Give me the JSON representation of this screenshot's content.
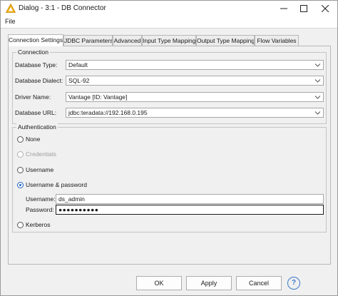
{
  "window": {
    "title": "Dialog - 3:1 - DB Connector"
  },
  "menu": {
    "file": "File"
  },
  "tabs": [
    {
      "label": "Connection Settings",
      "active": true
    },
    {
      "label": "JDBC Parameters",
      "active": false
    },
    {
      "label": "Advanced",
      "active": false
    },
    {
      "label": "Input Type Mapping",
      "active": false
    },
    {
      "label": "Output Type Mapping",
      "active": false
    },
    {
      "label": "Flow Variables",
      "active": false
    }
  ],
  "connection": {
    "title": "Connection",
    "database_type_label": "Database Type:",
    "database_type_value": "Default",
    "database_dialect_label": "Database Dialect:",
    "database_dialect_value": "SQL-92",
    "driver_name_label": "Driver Name:",
    "driver_name_value": "Vantage [ID: Vantage]",
    "database_url_label": "Database URL:",
    "database_url_value": "jdbc:teradata://192.168.0.195"
  },
  "authentication": {
    "title": "Authentication",
    "options": [
      {
        "label": "None",
        "checked": false,
        "disabled": false
      },
      {
        "label": "Credentials",
        "checked": false,
        "disabled": true
      },
      {
        "label": "Username",
        "checked": false,
        "disabled": false
      },
      {
        "label": "Username & password",
        "checked": true,
        "disabled": false
      },
      {
        "label": "Kerberos",
        "checked": false,
        "disabled": false
      }
    ],
    "username_label": "Username:",
    "username_value": "ds_admin",
    "password_label": "Password:",
    "password_value": "●●●●●●●●●●"
  },
  "buttons": {
    "ok": "OK",
    "apply": "Apply",
    "cancel": "Cancel",
    "help": "?"
  },
  "colors": {
    "accent": "#1b62c2",
    "app_icon": "#f2b01e"
  }
}
